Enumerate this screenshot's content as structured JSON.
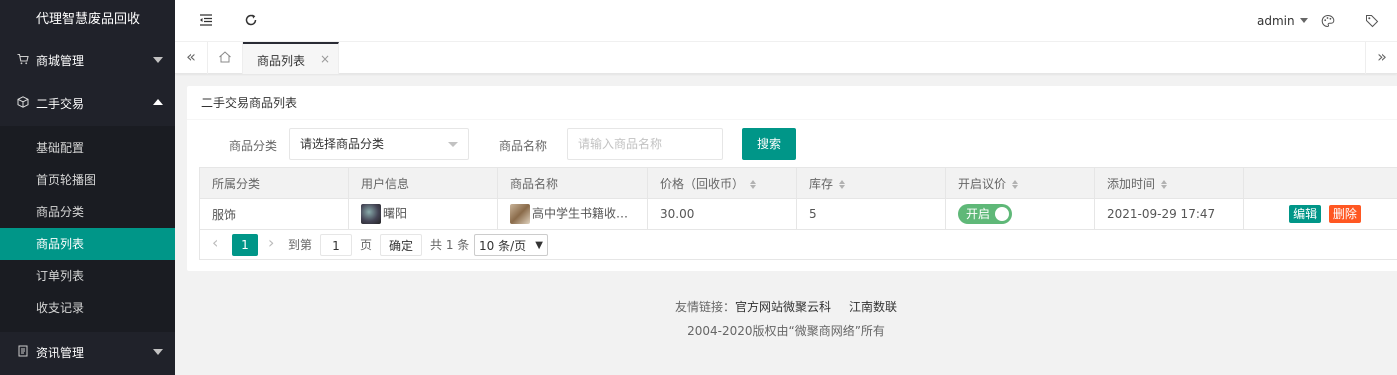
{
  "sidebar": {
    "brand": "代理智慧废品回收",
    "groups": [
      {
        "label": "商城管理",
        "icon": "cart-icon"
      },
      {
        "label": "二手交易",
        "icon": "cube-icon"
      },
      {
        "label": "资讯管理",
        "icon": "document-icon"
      }
    ],
    "sub_items": [
      {
        "label": "基础配置",
        "active": false
      },
      {
        "label": "首页轮播图",
        "active": false
      },
      {
        "label": "商品分类",
        "active": false
      },
      {
        "label": "商品列表",
        "active": true
      },
      {
        "label": "订单列表",
        "active": false
      },
      {
        "label": "收支记录",
        "active": false
      }
    ]
  },
  "header": {
    "user": "admin",
    "icons": [
      "menu-fold-icon",
      "refresh-icon",
      "palette-icon",
      "tag-icon"
    ]
  },
  "tabs": {
    "active_tab": "商品列表",
    "close_glyph": "×"
  },
  "card": {
    "title": "二手交易商品列表",
    "filters": {
      "category_label": "商品分类",
      "category_value": "请选择商品分类",
      "name_label": "商品名称",
      "name_placeholder": "请输入商品名称",
      "search_button": "搜索"
    }
  },
  "table": {
    "columns": [
      "所属分类",
      "用户信息",
      "商品名称",
      "价格（回收币）",
      "库存",
      "开启议价",
      "添加时间",
      ""
    ],
    "rows": [
      {
        "category": "服饰",
        "user": "曙阳",
        "product": "高中学生书籍收…",
        "price": "30.00",
        "stock": "5",
        "bargain": "开启",
        "added": "2021-09-29 17:47",
        "edit": "编辑",
        "delete": "删除"
      }
    ]
  },
  "pager": {
    "prev": "‹",
    "next": "›",
    "current": "1",
    "goto_label": "到第",
    "goto_value": "1",
    "page_unit": "页",
    "confirm": "确定",
    "total": "共 1 条",
    "page_size": "10 条/页"
  },
  "footer": {
    "links_label": "友情链接：",
    "links": [
      "官方网站微聚云科",
      "江南数联"
    ],
    "copyright": "2004-2020版权由“微聚商网络”所有"
  }
}
